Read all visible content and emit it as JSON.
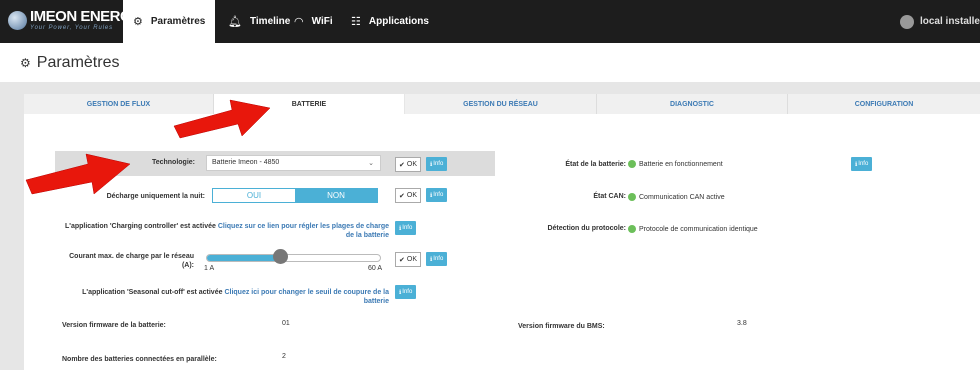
{
  "nav": {
    "logo_name": "IMEON ENERGY",
    "logo_tagline": "Your Power, Your Rules",
    "items": [
      {
        "label": "Paramètres",
        "icon": "sliders-icon"
      },
      {
        "label": "Timeline",
        "icon": "bell-icon"
      },
      {
        "label": "WiFi",
        "icon": "wifi-icon"
      },
      {
        "label": "Applications",
        "icon": "apps-icon"
      }
    ],
    "user": "local installe"
  },
  "page": {
    "title": "Paramètres"
  },
  "tabs": [
    "GESTION DE FLUX",
    "BATTERIE",
    "GESTION DU RÉSEAU",
    "DIAGNOSTIC",
    "CONFIGURATION"
  ],
  "form": {
    "technologie_label": "Technologie:",
    "technologie_value": "Batterie Imeon - 4850",
    "decharge_label": "Décharge uniquement la nuit:",
    "decharge_oui": "OUI",
    "decharge_non": "NON",
    "charging_label": "L'application 'Charging controller' est activée",
    "charging_link": "Cliquez sur ce lien pour régler les plages de charge de la batterie",
    "courant_label": "Courant max. de charge par le réseau (A):",
    "courant_min": "1 A",
    "courant_max": "60 A",
    "courant_fraction": 0.42,
    "seasonal_label": "L'application 'Seasonal cut-off' est activée",
    "seasonal_link": "Cliquez ici pour changer le seuil de coupure de la batterie",
    "ok_label": "OK",
    "info_label": "Info",
    "firmware_label": "Version firmware de la batterie:",
    "firmware_value": "01",
    "nb_batteries_label": "Nombre des batteries connectées en parallèle:",
    "nb_batteries_value": "2"
  },
  "status": {
    "etat_batterie_label": "État de la batterie:",
    "etat_batterie_value": "Batterie en fonctionnement",
    "etat_can_label": "État CAN:",
    "etat_can_value": "Communication CAN active",
    "protocole_label": "Détection du protocole:",
    "protocole_value": "Protocole de communication identique",
    "bms_label": "Version firmware du BMS:",
    "bms_value": "3.8",
    "ok_color": "#6cbf5a"
  },
  "colors": {
    "accent": "#4bb0d6",
    "link": "#3c7ab4",
    "nav_bg": "#1d1d1d",
    "arrow": "#e8170c"
  }
}
